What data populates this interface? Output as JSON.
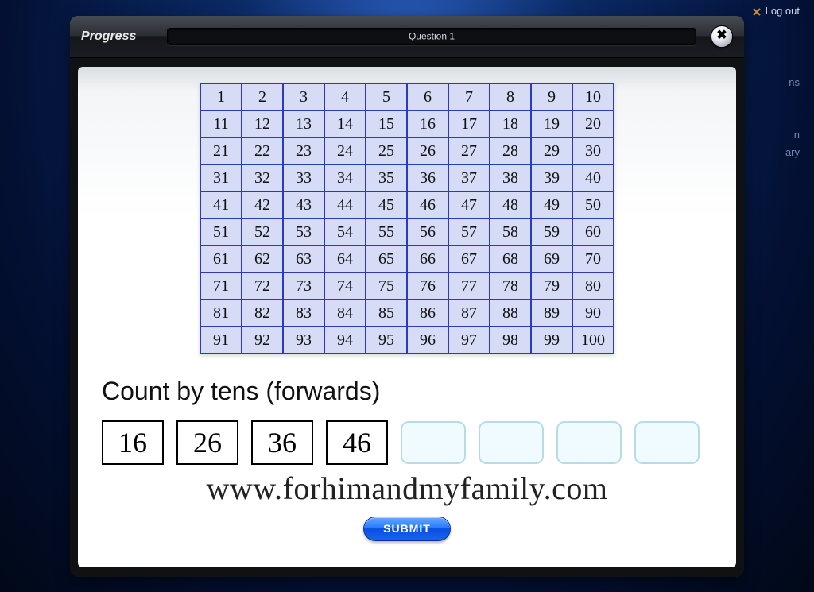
{
  "background": {
    "logout_label": "Log out",
    "frag1": "ns",
    "frag2": "n",
    "frag3": "ary"
  },
  "modal": {
    "title": "Progress",
    "progress_label": "Question 1",
    "close_symbol": "✖"
  },
  "grid": {
    "rows": [
      [
        1,
        2,
        3,
        4,
        5,
        6,
        7,
        8,
        9,
        10
      ],
      [
        11,
        12,
        13,
        14,
        15,
        16,
        17,
        18,
        19,
        20
      ],
      [
        21,
        22,
        23,
        24,
        25,
        26,
        27,
        28,
        29,
        30
      ],
      [
        31,
        32,
        33,
        34,
        35,
        36,
        37,
        38,
        39,
        40
      ],
      [
        41,
        42,
        43,
        44,
        45,
        46,
        47,
        48,
        49,
        50
      ],
      [
        51,
        52,
        53,
        54,
        55,
        56,
        57,
        58,
        59,
        60
      ],
      [
        61,
        62,
        63,
        64,
        65,
        66,
        67,
        68,
        69,
        70
      ],
      [
        71,
        72,
        73,
        74,
        75,
        76,
        77,
        78,
        79,
        80
      ],
      [
        81,
        82,
        83,
        84,
        85,
        86,
        87,
        88,
        89,
        90
      ],
      [
        91,
        92,
        93,
        94,
        95,
        96,
        97,
        98,
        99,
        100
      ]
    ]
  },
  "question": {
    "prompt": "Count by tens (forwards)",
    "given": [
      "16",
      "26",
      "36",
      "46"
    ],
    "blanks": [
      "",
      "",
      "",
      ""
    ]
  },
  "watermark": "www.forhimandmyfamily.com",
  "submit_label": "SUBMIT"
}
